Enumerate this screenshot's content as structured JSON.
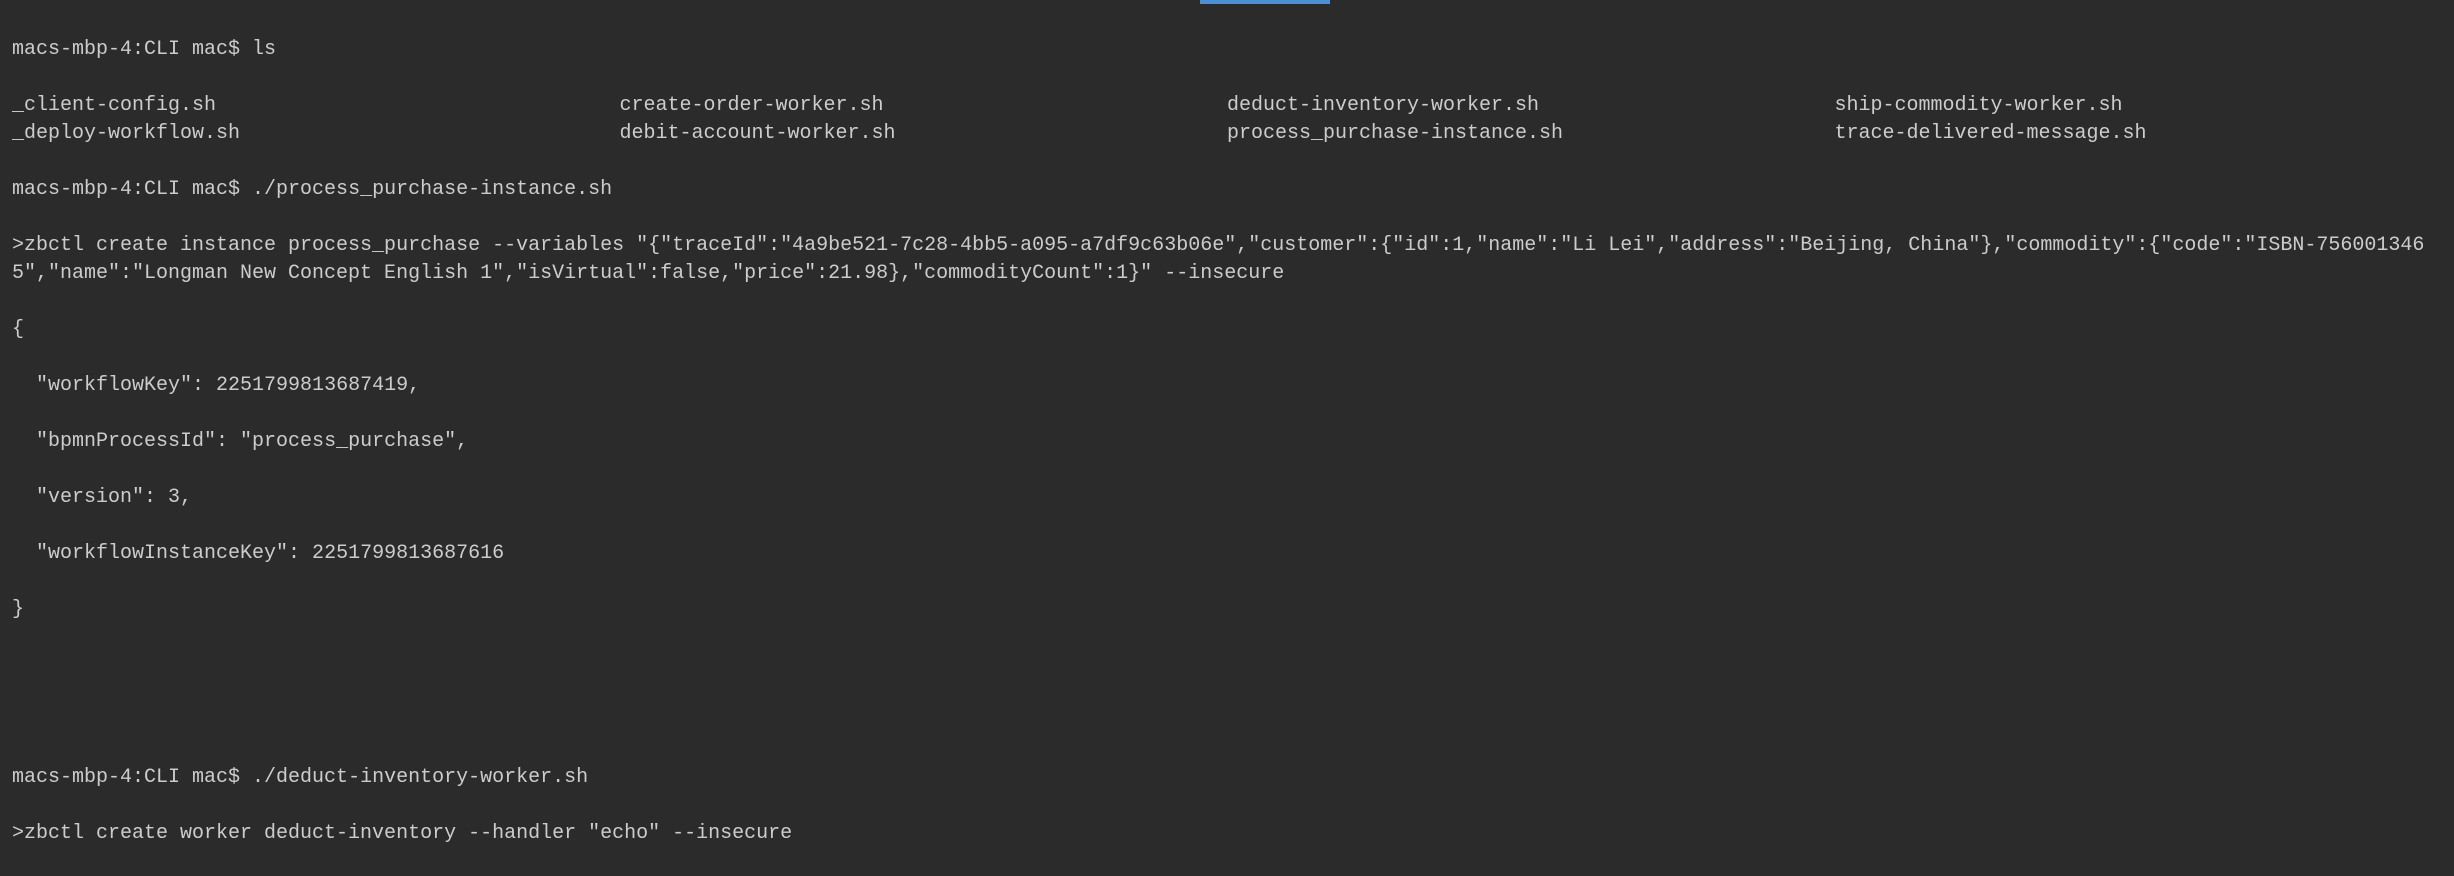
{
  "prompt_prefix": "macs-mbp-4:CLI mac$ ",
  "commands": {
    "ls": "ls",
    "script1": "./process_purchase-instance.sh",
    "script2": "./deduct-inventory-worker.sh"
  },
  "ls_output": [
    "_client-config.sh",
    "create-order-worker.sh",
    "deduct-inventory-worker.sh",
    "ship-commodity-worker.sh",
    "_deploy-workflow.sh",
    "debit-account-worker.sh",
    "process_purchase-instance.sh",
    "trace-delivered-message.sh"
  ],
  "script1_output": {
    "command_line": ">zbctl create instance process_purchase --variables \"{\"traceId\":\"4a9be521-7c28-4bb5-a095-a7df9c63b06e\",\"customer\":{\"id\":1,\"name\":\"Li Lei\",\"address\":\"Beijing, China\"},\"commodity\":{\"code\":\"ISBN-7560013465\",\"name\":\"Longman New Concept English 1\",\"isVirtual\":false,\"price\":21.98},\"commodityCount\":1}\" --insecure",
    "json_open": "{",
    "line1": "  \"workflowKey\": 2251799813687419,",
    "line2": "  \"bpmnProcessId\": \"process_purchase\",",
    "line3": "  \"version\": 3,",
    "line4": "  \"workflowInstanceKey\": 2251799813687616",
    "json_close": "}"
  },
  "script2_output": {
    "command_line": ">zbctl create worker deduct-inventory --handler \"echo\" --insecure"
  }
}
